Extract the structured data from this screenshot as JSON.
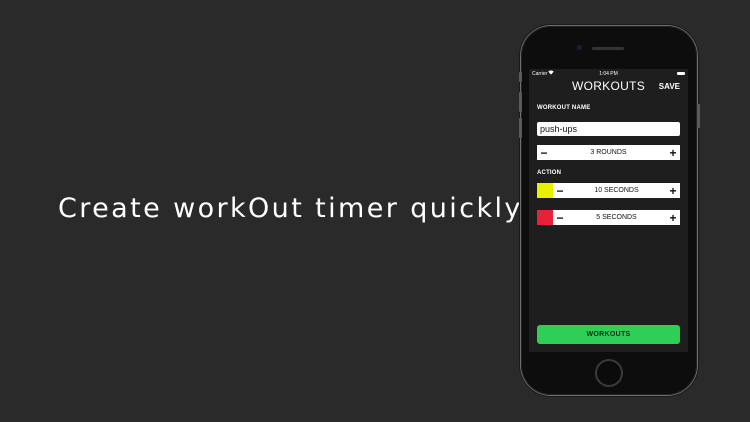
{
  "tagline": "Create workOut timer quickly",
  "status_bar": {
    "carrier": "Carrier",
    "time": "1:04 PM"
  },
  "nav": {
    "title": "WORKOUTS",
    "save_label": "SAVE"
  },
  "workout_name": {
    "label": "WORKOUT NAME",
    "value": "push-ups"
  },
  "rounds": {
    "value": "3 ROUNDS",
    "minus": "−",
    "plus": "+"
  },
  "action": {
    "label": "ACTION",
    "items": [
      {
        "color": "#e8f000",
        "value": "10 SECONDS",
        "minus": "−",
        "plus": "+"
      },
      {
        "color": "#e8203a",
        "value": "5 SECONDS",
        "minus": "−",
        "plus": "+"
      }
    ]
  },
  "bottom_button": {
    "label": "WORKOUTS"
  },
  "colors": {
    "accent_green": "#2fcf57",
    "background": "#2a2a2a"
  }
}
